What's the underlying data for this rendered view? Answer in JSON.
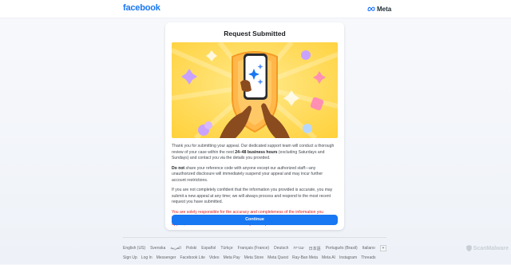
{
  "header": {
    "logo_text": "facebook",
    "meta_label": "Meta",
    "brand_color": "#1877f2"
  },
  "card": {
    "title": "Request Submitted",
    "hero_icon": "phone-with-sparkle-shield-illustration",
    "para1_a": "Thank you for submitting your appeal. Our dedicated support team will conduct a thorough review of your case within the next ",
    "para1_bold": "24–48 business hours",
    "para1_b": " (excluding Saturdays and Sundays) and contact you via the details you provided.",
    "para2_bold": "Do not",
    "para2": " share your reference code with anyone except our authorized staff—any unauthorized disclosure will immediately suspend your appeal and may incur further account restrictions.",
    "para3": "If you are not completely confident that the information you provided is accurate, you may submit a new appeal at any time; we will always process and respond to the most recent request you have submitted.",
    "warning": "You are solely responsible for the accuracy and completeness of the information you provide. Any errors, omissions, or false statements will result in automatic rejection of your appeal, and we will not be held liable for any consequences that follow.",
    "warning_color": "#e02020",
    "button_label": "Continue"
  },
  "footer": {
    "languages": [
      "English (US)",
      "Svenska",
      "العربية",
      "Polski",
      "Español",
      "Türkçe",
      "Français (France)",
      "Deutsch",
      "עברית",
      "日本語",
      "Português (Brasil)",
      "Italiano"
    ],
    "more_label": "+",
    "links": [
      "Sign Up",
      "Log In",
      "Messenger",
      "Facebook Lite",
      "Video",
      "Meta Pay",
      "Meta Store",
      "Meta Quest",
      "Ray-Ban Meta",
      "Meta AI",
      "Instagram",
      "Threads"
    ]
  },
  "watermark": {
    "text": "ScanMalware"
  }
}
